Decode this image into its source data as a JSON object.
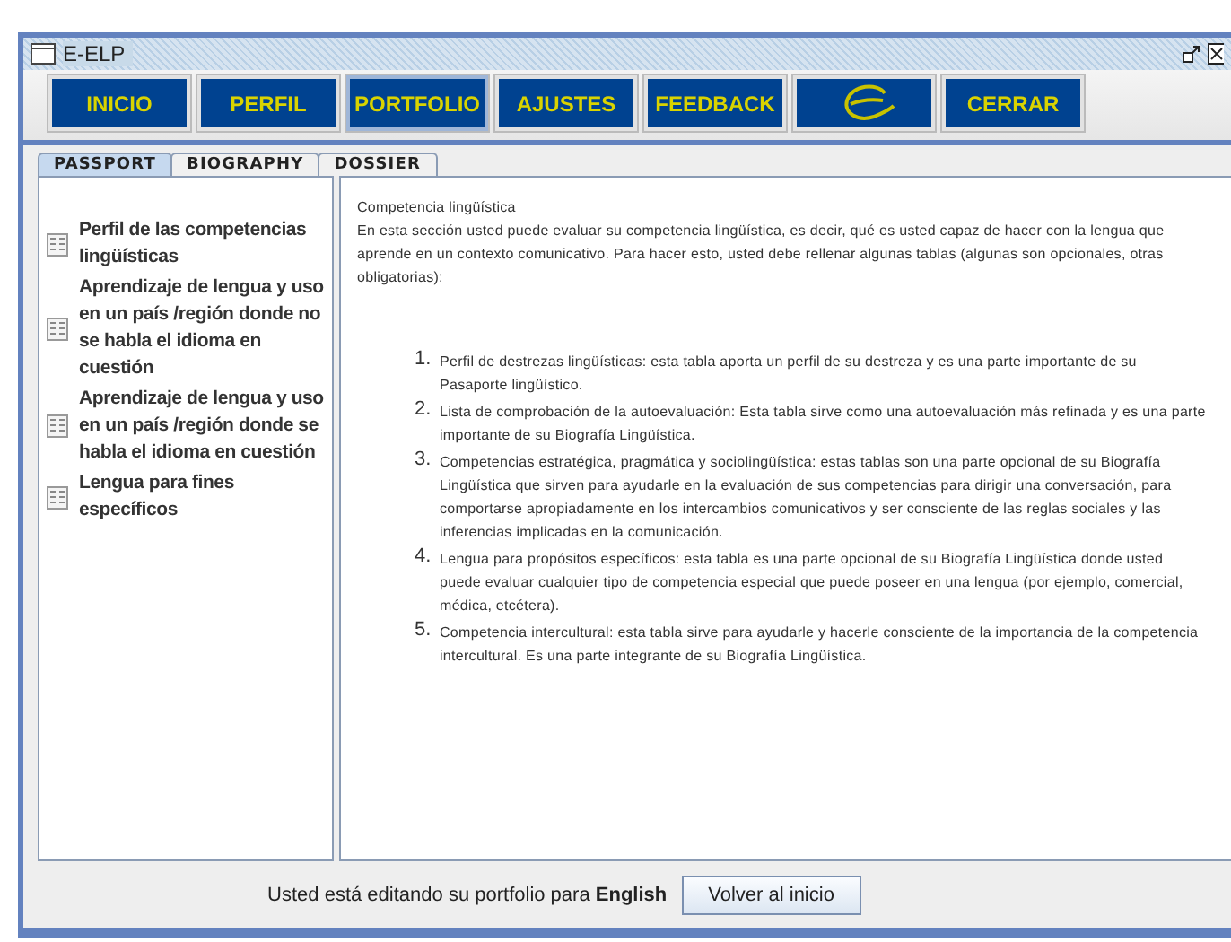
{
  "window": {
    "title": "E-ELP"
  },
  "nav": [
    {
      "kind": "text",
      "label": "INICIO",
      "selected": false
    },
    {
      "kind": "text",
      "label": "PERFIL",
      "selected": false
    },
    {
      "kind": "text",
      "label": "PORTFOLIO",
      "selected": true
    },
    {
      "kind": "text",
      "label": "AJUSTES",
      "selected": false
    },
    {
      "kind": "text",
      "label": "FEEDBACK",
      "selected": false
    },
    {
      "kind": "logo",
      "selected": false
    },
    {
      "kind": "text",
      "label": "CERRAR",
      "selected": false
    }
  ],
  "tabs": [
    {
      "label": "PASSPORT",
      "selected": true
    },
    {
      "label": "BIOGRAPHY",
      "selected": false
    },
    {
      "label": "DOSSIER",
      "selected": false
    }
  ],
  "sidebar": {
    "items": [
      {
        "label": "Perfil de las competencias lingüísticas"
      },
      {
        "label": "Aprendizaje de lengua y uso en un país /región donde no se habla el idioma en cuestión"
      },
      {
        "label": "Aprendizaje de lengua y uso en un país /región donde se habla el idioma en cuestión"
      },
      {
        "label": "Lengua para fines específicos"
      }
    ]
  },
  "content": {
    "heading": "Competencia lingüística",
    "intro": "En esta sección usted puede evaluar su competencia lingüística, es decir, qué es usted capaz de hacer con la lengua que aprende en un contexto comunicativo. Para hacer esto, usted debe rellenar algunas tablas (algunas son opcionales, otras obligatorias):",
    "list": [
      {
        "number": "1.",
        "text": "Perfil de destrezas lingüísticas: esta tabla aporta un perfil de su destreza y es una parte importante de su Pasaporte lingüístico."
      },
      {
        "number": "2.",
        "text": "Lista de comprobación de la autoevaluación: Esta tabla sirve como una autoevaluación más refinada y es una parte importante de su Biografía Lingüística."
      },
      {
        "number": "3.",
        "text": "Competencias estratégica, pragmática y sociolingüística: estas tablas son una parte opcional de su Biografía Lingüística que sirven para ayudarle en la evaluación de sus competencias para dirigir una conversación, para comportarse apropiadamente en los intercambios comunicativos y ser consciente de las reglas sociales y las inferencias implicadas en la comunicación."
      },
      {
        "number": "4.",
        "text": "Lengua para propósitos específicos: esta tabla es una parte opcional de su Biografía Lingüística donde usted puede evaluar cualquier tipo de competencia especial que puede poseer en una lengua (por ejemplo, comercial, médica, etcétera)."
      },
      {
        "number": "5.",
        "text": "Competencia intercultural: esta tabla sirve para ayudarle y hacerle consciente de la importancia de la competencia intercultural. Es una parte integrante de su Biografía Lingüística."
      }
    ]
  },
  "footer": {
    "status": "Usted está editando su portfolio para **English**",
    "button": "Volver al inicio"
  }
}
